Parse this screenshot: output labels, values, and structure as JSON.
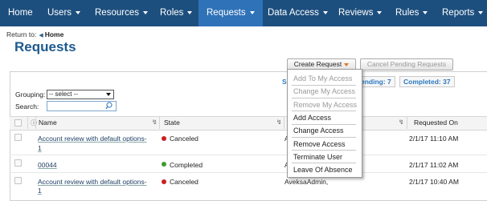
{
  "nav": {
    "items": [
      {
        "label": "Home"
      },
      {
        "label": "Users"
      },
      {
        "label": "Resources"
      },
      {
        "label": "Roles"
      },
      {
        "label": "Requests"
      },
      {
        "label": "Data Access"
      },
      {
        "label": "Reviews"
      },
      {
        "label": "Rules"
      },
      {
        "label": "Reports"
      }
    ],
    "active": "Requests"
  },
  "return_to": {
    "prefix": "Return to:",
    "link": "Home"
  },
  "page_title": "Requests",
  "toolbar": {
    "create_request": "Create Request",
    "cancel_pending": "Cancel Pending Requests"
  },
  "summary": {
    "show_label": "Sh",
    "pending_label": "ending: 7",
    "completed_label": "Completed: 37"
  },
  "filters": {
    "grouping_label": "Grouping:",
    "grouping_value": "-- select --",
    "search_label": "Search:"
  },
  "table": {
    "columns": [
      {
        "label": "Name"
      },
      {
        "label": "State"
      },
      {
        "label": "Requested On"
      }
    ],
    "rows": [
      {
        "name": "Account review with default options-1",
        "name_line1": "Account review with default options-",
        "name_line2": "1",
        "state": "Canceled",
        "state_color": "#cc1f1f",
        "requester": "A",
        "requested_on": "2/1/17 11:10 AM"
      },
      {
        "name": "00044",
        "name_line1": "00044",
        "name_line2": "",
        "state": "Completed",
        "state_color": "#3f9a2f",
        "requester": "A",
        "requested_on": "2/1/17 11:02 AM"
      },
      {
        "name": "Account review with default options-1",
        "name_line1": "Account review with default options-",
        "name_line2": "1",
        "state": "Canceled",
        "state_color": "#cc1f1f",
        "requester": "AveksaAdmin,",
        "requested_on": "2/1/17 10:40 AM"
      }
    ]
  },
  "create_menu": {
    "disabled_items": [
      "Add To My Access",
      "Change My Access",
      "Remove My Access"
    ],
    "enabled_items": [
      "Add Access",
      "Change Access",
      "Remove Access",
      "Terminate User",
      "Leave Of Absence"
    ]
  },
  "colors": {
    "nav_bg": "#1d4f7e",
    "nav_active": "#2f72b8",
    "title": "#1e5a8e",
    "link_blue": "#2c78c0"
  }
}
